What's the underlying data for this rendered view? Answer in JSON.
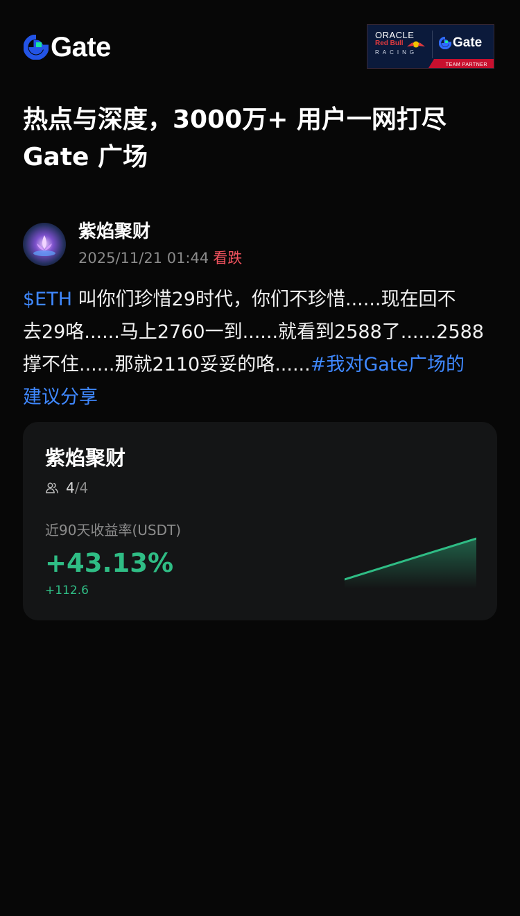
{
  "brand": {
    "name": "Gate",
    "accent": "#2354e6",
    "accent_secondary": "#17e6a1"
  },
  "partner_badge": {
    "oracle": "ORACLE",
    "red_bull": "Red Bull",
    "racing": "RACING",
    "gate": "Gate",
    "strip": "TEAM PARTNER"
  },
  "headline": {
    "line1": "热点与深度，3000万+ 用户一网打尽",
    "line2": "Gate 广场"
  },
  "post": {
    "author": "紫焰聚财",
    "timestamp": "2025/11/21 01:44",
    "sentiment": "看跌",
    "sentiment_color": "#f0525e",
    "body": {
      "line1_tag": "$ETH",
      "line1_text": " 叫你们珍惜29时代，你们不珍惜......现在回不",
      "line2": "去29咯......马上2760一到......就看到2588了......2588",
      "line3_text": "撑不住......那就2110妥妥的咯......",
      "line3_tag": "#我对Gate广场的",
      "line4_tag": "建议分享"
    }
  },
  "copy_card": {
    "name": "紫焰聚财",
    "members_current": "4",
    "members_total": "/4",
    "label": "近90天收益率(USDT)",
    "return_pct": "+43.13%",
    "return_abs": "+112.6",
    "positive_color": "#2fbd85",
    "icons": {
      "members": "people-icon"
    }
  }
}
